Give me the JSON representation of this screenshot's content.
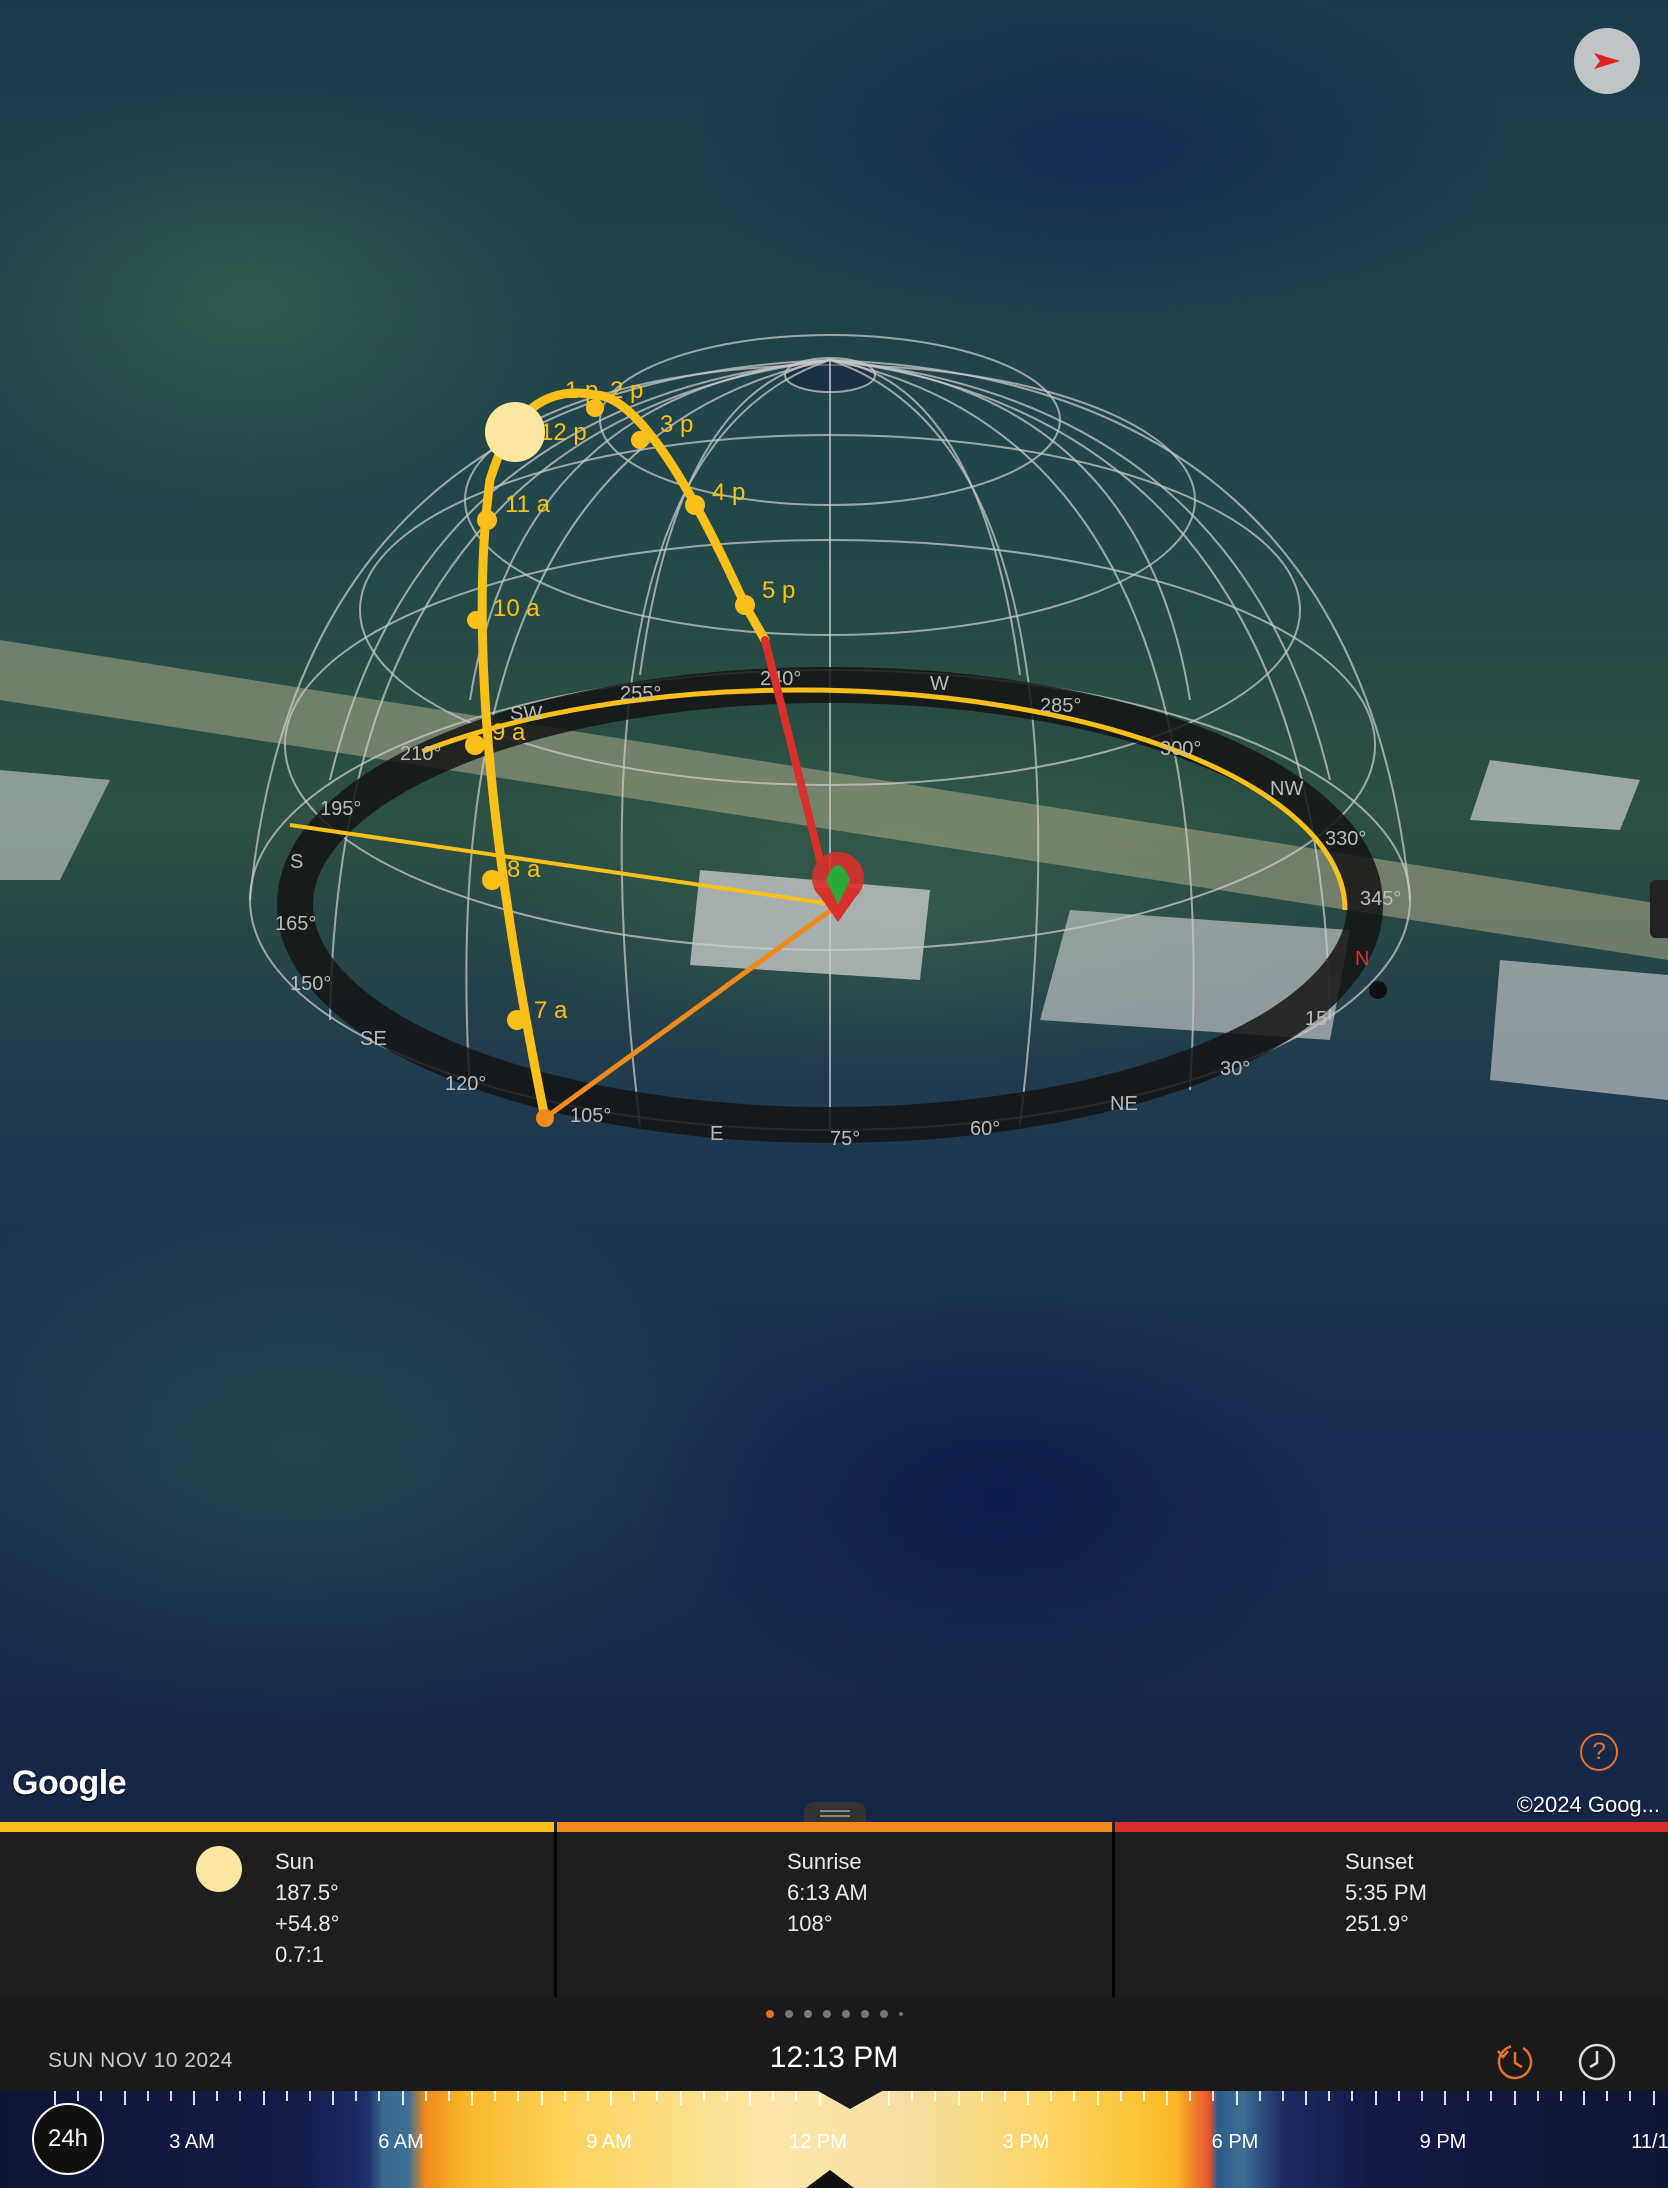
{
  "map": {
    "attribution_logo": "Google",
    "copyright": "©2024 Goog...",
    "help_label": "?",
    "compass_ring_labels": [
      "255°",
      "W",
      "285°",
      "300°",
      "NW",
      "330°",
      "345°",
      "N",
      "15°",
      "30°",
      "NE",
      "60°",
      "75°",
      "E",
      "105°",
      "120°",
      "SE",
      "150°",
      "165°",
      "S",
      "195°",
      "210°",
      "SW",
      "240°"
    ],
    "sun_path_hours": [
      "1 p",
      "2 p",
      "12 p",
      "3 p",
      "4 p",
      "5 p",
      "11 a",
      "10 a",
      "9 a",
      "8 a",
      "7 a"
    ],
    "colors": {
      "sun_path": "#f9c01a",
      "sunrise_line": "#f08a1a",
      "sunset_line": "#d8302a",
      "sun_position_line": "#f9c01a",
      "location_pin": "#d8302a"
    }
  },
  "info": {
    "sun": {
      "title": "Sun",
      "azimuth": "187.5°",
      "elevation": "+54.8°",
      "ratio": "0.7:1",
      "color": "#f9c01a"
    },
    "sunrise": {
      "title": "Sunrise",
      "time": "6:13 AM",
      "azimuth": "108°",
      "color": "#f08a1a"
    },
    "sunset": {
      "title": "Sunset",
      "time": "5:35 PM",
      "azimuth": "251.9°",
      "color": "#d8302a"
    }
  },
  "pager": {
    "count": 8,
    "active": 0
  },
  "time_bar": {
    "date": "SUN NOV 10 2024",
    "time": "12:13 PM",
    "history_icon": "history-icon",
    "clock_icon": "clock-icon"
  },
  "timeline": {
    "mode_button": "24h",
    "hour_labels": [
      "3 AM",
      "6 AM",
      "9 AM",
      "12 PM",
      "3 PM",
      "6 PM",
      "9 PM",
      "11/1"
    ]
  }
}
